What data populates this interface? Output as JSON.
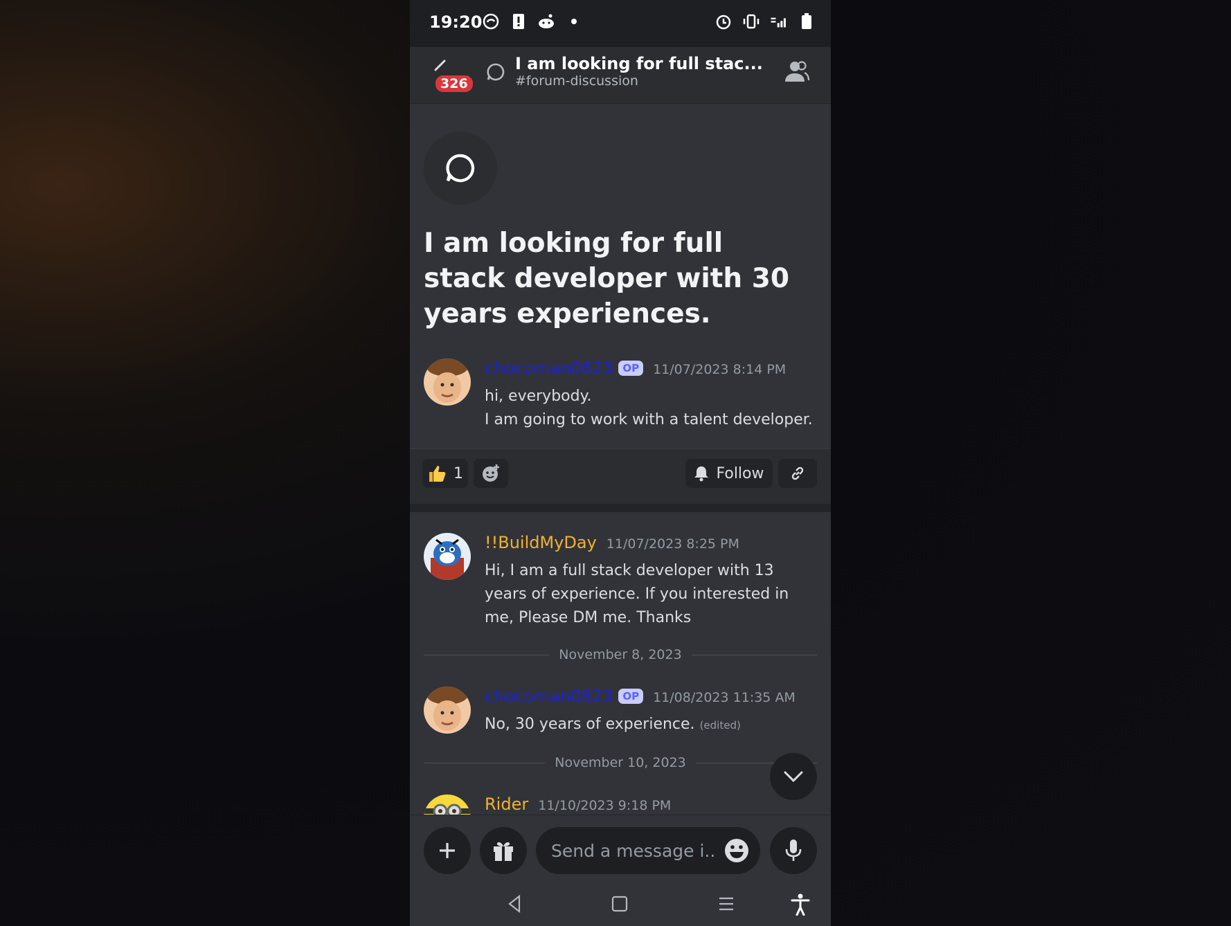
{
  "status_bar": {
    "time": "19:20"
  },
  "header": {
    "unread_badge": "326",
    "title": "I am looking for full stac...",
    "channel": "#forum-discussion"
  },
  "post": {
    "title": "I am looking for full stack developer with 30 years experiences."
  },
  "messages": [
    {
      "username": "chocoman0823",
      "op_label": "OP",
      "timestamp": "11/07/2023 8:14 PM",
      "lines": [
        "hi, everybody.",
        "I am going to work with a talent developer."
      ],
      "name_color": "#1c22d8"
    },
    {
      "username": "!!BuildMyDay",
      "timestamp": "11/07/2023 8:25 PM",
      "text": "Hi, I am a full stack developer with 13 years of experience. If you interested in me, Please DM me. Thanks",
      "name_color": "#f0b232"
    },
    {
      "username": "chocoman0823",
      "op_label": "OP",
      "timestamp": "11/08/2023 11:35 AM",
      "text": "No, 30 years of experience.",
      "edited_label": "(edited)",
      "name_color": "#1c22d8"
    },
    {
      "username": "Rider",
      "timestamp": "11/10/2023 9:18 PM",
      "name_color": "#f0b232"
    }
  ],
  "reactions": {
    "thumbs_up_count": "1",
    "follow_label": "Follow"
  },
  "date_separators": [
    "November 8, 2023",
    "November 10, 2023"
  ],
  "composer": {
    "placeholder": "Send a message i..."
  },
  "colors": {
    "background": "#313338",
    "header": "#2b2d31",
    "badge": "#da373c",
    "op_badge": "#c9cdfb"
  }
}
